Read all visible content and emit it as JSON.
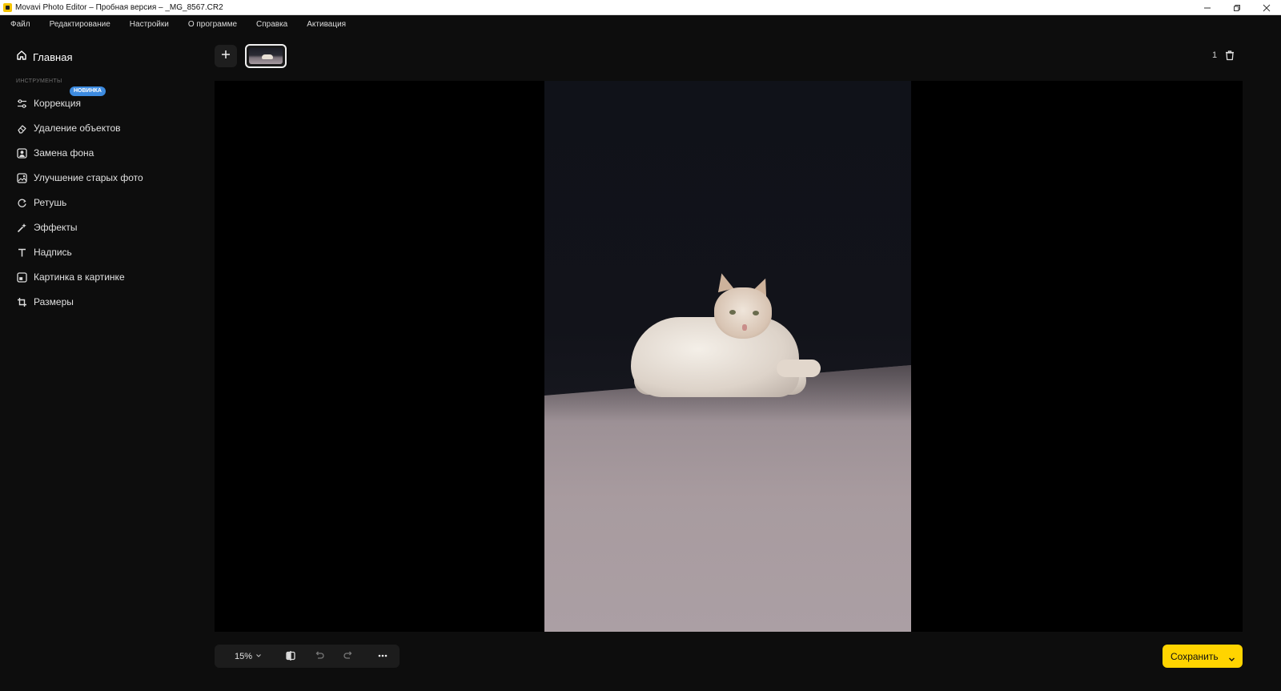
{
  "window": {
    "title": "Movavi Photo Editor – Пробная версия – _MG_8567.CR2",
    "controls": [
      "minimize-icon",
      "restore-icon",
      "close-icon"
    ]
  },
  "menu": [
    "Файл",
    "Редактирование",
    "Настройки",
    "О программе",
    "Справка",
    "Активация"
  ],
  "sidebar": {
    "home_label": "Главная",
    "tools_caption": "ИНСТРУМЕНТЫ",
    "new_badge": "НОВИНКА",
    "tools": [
      {
        "label": "Коррекция",
        "icon": "sliders-icon"
      },
      {
        "label": "Удаление объектов",
        "icon": "eraser-icon"
      },
      {
        "label": "Замена фона",
        "icon": "portrait-icon"
      },
      {
        "label": "Улучшение старых фото",
        "icon": "photo-restore-icon"
      },
      {
        "label": "Ретушь",
        "icon": "retouch-icon"
      },
      {
        "label": "Эффекты",
        "icon": "sparkle-icon"
      },
      {
        "label": "Надпись",
        "icon": "text-icon"
      },
      {
        "label": "Картинка в картинке",
        "icon": "picture-in-picture-icon"
      },
      {
        "label": "Размеры",
        "icon": "crop-icon"
      }
    ]
  },
  "topstrip": {
    "image_count": "1"
  },
  "bottom": {
    "zoom": "15%",
    "save_label": "Сохранить"
  },
  "colors": {
    "accent": "#ffd400",
    "badge": "#3d8be0",
    "background": "#0d0d0d"
  }
}
